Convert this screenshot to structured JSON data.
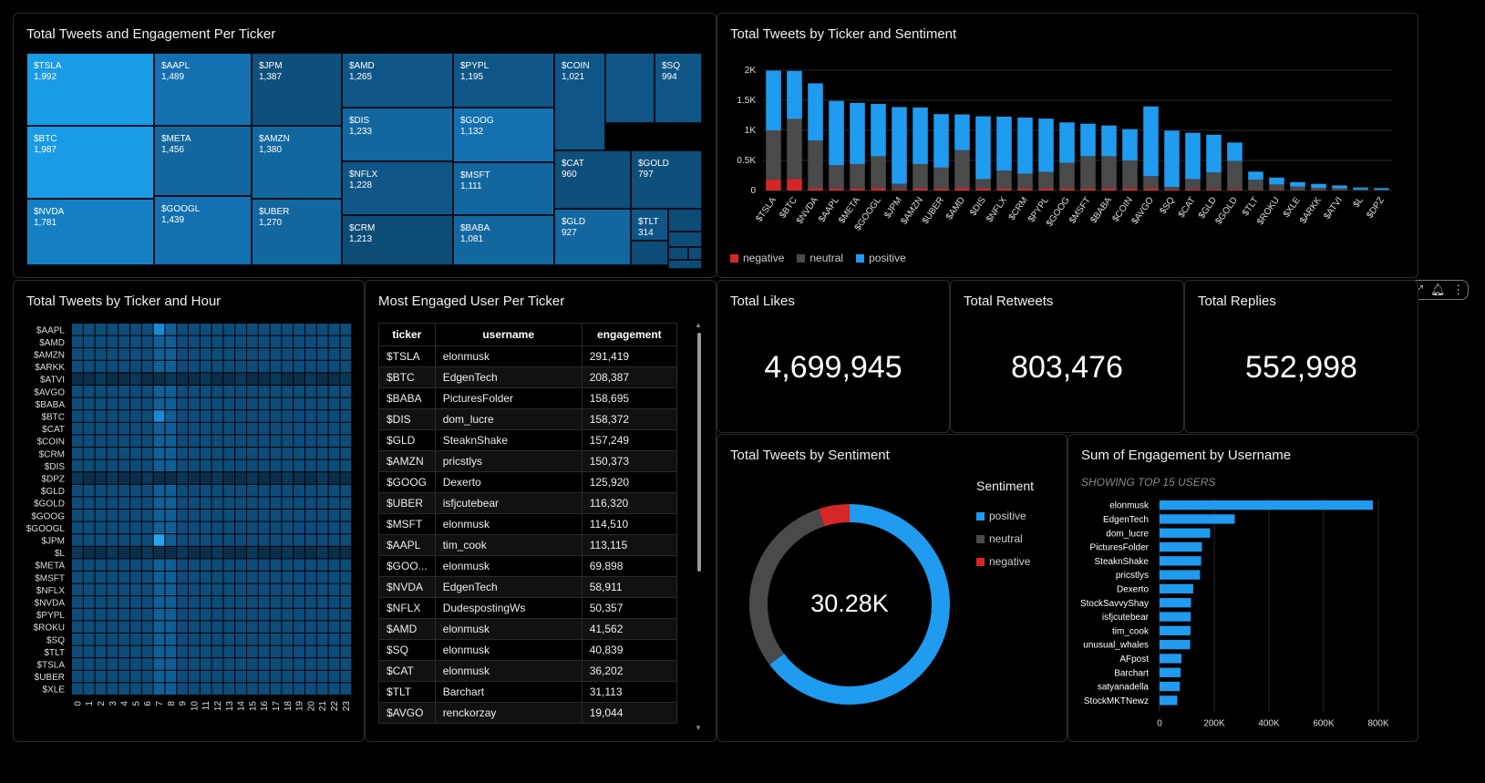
{
  "treemap": {
    "title": "Total Tweets and Engagement Per Ticker",
    "cells": [
      {
        "label": "$TSLA",
        "value": "1,992",
        "color": "#1a9be6"
      },
      {
        "label": "$BTC",
        "value": "1,987",
        "color": "#1a9be6"
      },
      {
        "label": "$NVDA",
        "value": "1,781",
        "color": "#157fc4"
      },
      {
        "label": "$AAPL",
        "value": "1,489",
        "color": "#1470b0"
      },
      {
        "label": "$META",
        "value": "1,456",
        "color": "#13679f"
      },
      {
        "label": "$GOOGL",
        "value": "1,439",
        "color": "#1470b0"
      },
      {
        "label": "$JPM",
        "value": "1,387",
        "color": "#0e4f7c"
      },
      {
        "label": "$AMZN",
        "value": "1,380",
        "color": "#13679f"
      },
      {
        "label": "$UBER",
        "value": "1,270",
        "color": "#13679f"
      },
      {
        "label": "$AMD",
        "value": "1,265",
        "color": "#0f5687"
      },
      {
        "label": "$DIS",
        "value": "1,233",
        "color": "#13679f"
      },
      {
        "label": "$NFLX",
        "value": "1,228",
        "color": "#0f5687"
      },
      {
        "label": "$CRM",
        "value": "1,213",
        "color": "#0d4c77"
      },
      {
        "label": "$PYPL",
        "value": "1,195",
        "color": "#0f5687"
      },
      {
        "label": "$GOOG",
        "value": "1,132",
        "color": "#1470b0"
      },
      {
        "label": "$MSFT",
        "value": "1,111",
        "color": "#13679f"
      },
      {
        "label": "$BABA",
        "value": "1,081",
        "color": "#13679f"
      },
      {
        "label": "$COIN",
        "value": "1,021",
        "color": "#0f5687"
      },
      {
        "label": "",
        "value": "",
        "color": "#0f5687"
      },
      {
        "label": "$SQ",
        "value": "994",
        "color": "#0f5687"
      },
      {
        "label": "$CAT",
        "value": "960",
        "color": "#0e4f7c"
      },
      {
        "label": "$GOLD",
        "value": "797",
        "color": "#0e4f7c"
      },
      {
        "label": "$GLD",
        "value": "927",
        "color": "#13679f"
      },
      {
        "label": "$TLT",
        "value": "314",
        "color": "#0f5687"
      },
      {
        "label": "",
        "value": "",
        "color": "#0d4c77"
      },
      {
        "label": "",
        "value": "",
        "color": "#0d4c77"
      },
      {
        "label": "",
        "value": "",
        "color": "#0d4c77"
      },
      {
        "label": "",
        "value": "",
        "color": "#0d4c77"
      },
      {
        "label": "",
        "value": "",
        "color": "#0d4c77"
      },
      {
        "label": "",
        "value": "",
        "color": "#0d4c77"
      }
    ]
  },
  "sentiment_chart": {
    "title": "Total Tweets by Ticker and Sentiment",
    "legend": [
      {
        "label": "negative",
        "color": "#d62728"
      },
      {
        "label": "neutral",
        "color": "#4a4a4a"
      },
      {
        "label": "positive",
        "color": "#1f9bef"
      }
    ]
  },
  "heatmap": {
    "title": "Total Tweets by Ticker and Hour",
    "rows": [
      "$AAPL",
      "$AMD",
      "$AMZN",
      "$ARKK",
      "$ATVI",
      "$AVGO",
      "$BABA",
      "$BTC",
      "$CAT",
      "$COIN",
      "$CRM",
      "$DIS",
      "$DPZ",
      "$GLD",
      "$GOLD",
      "$GOOG",
      "$GOOGL",
      "$JPM",
      "$L",
      "$META",
      "$MSFT",
      "$NFLX",
      "$NVDA",
      "$PYPL",
      "$ROKU",
      "$SQ",
      "$TLT",
      "$TSLA",
      "$UBER",
      "$XLE"
    ],
    "cols": [
      "0",
      "1",
      "2",
      "3",
      "4",
      "5",
      "6",
      "7",
      "8",
      "9",
      "10",
      "11",
      "12",
      "13",
      "14",
      "15",
      "16",
      "17",
      "18",
      "19",
      "20",
      "21",
      "22",
      "23"
    ]
  },
  "users_table": {
    "title": "Most Engaged User Per Ticker",
    "headers": [
      "ticker",
      "username",
      "engagement"
    ],
    "rows": [
      [
        "$TSLA",
        "elonmusk",
        "291,419"
      ],
      [
        "$BTC",
        "EdgenTech",
        "208,387"
      ],
      [
        "$BABA",
        "PicturesFolder",
        "158,695"
      ],
      [
        "$DIS",
        "dom_lucre",
        "158,372"
      ],
      [
        "$GLD",
        "SteaknShake",
        "157,249"
      ],
      [
        "$AMZN",
        "pricstlys",
        "150,373"
      ],
      [
        "$GOOG",
        "Dexerto",
        "125,920"
      ],
      [
        "$UBER",
        "isfjcutebear",
        "116,320"
      ],
      [
        "$MSFT",
        "elonmusk",
        "114,510"
      ],
      [
        "$AAPL",
        "tim_cook",
        "113,115"
      ],
      [
        "$GOO...",
        "elonmusk",
        "69,898"
      ],
      [
        "$NVDA",
        "EdgenTech",
        "58,911"
      ],
      [
        "$NFLX",
        "DudespostingWs",
        "50,357"
      ],
      [
        "$AMD",
        "elonmusk",
        "41,562"
      ],
      [
        "$SQ",
        "elonmusk",
        "40,839"
      ],
      [
        "$CAT",
        "elonmusk",
        "36,202"
      ],
      [
        "$TLT",
        "Barchart",
        "31,113"
      ],
      [
        "$AVGO",
        "renckorzay",
        "19,044"
      ]
    ]
  },
  "kpis": {
    "likes": {
      "title": "Total Likes",
      "value": "4,699,945"
    },
    "retweets": {
      "title": "Total Retweets",
      "value": "803,476"
    },
    "replies": {
      "title": "Total Replies",
      "value": "552,998"
    }
  },
  "donut": {
    "title": "Total Tweets by Sentiment",
    "center": "30.28K",
    "legend_title": "Sentiment",
    "legend": [
      {
        "label": "positive",
        "color": "#1f9bef"
      },
      {
        "label": "neutral",
        "color": "#4a4a4a"
      },
      {
        "label": "negative",
        "color": "#d62728"
      }
    ]
  },
  "engagement": {
    "title": "Sum of Engagement by Username",
    "subtitle": "SHOWING TOP 15 USERS"
  },
  "chart_data": [
    {
      "type": "bar",
      "stacked": true,
      "title": "Total Tweets by Ticker and Sentiment",
      "categories": [
        "$TSLA",
        "$BTC",
        "$NVDA",
        "$AAPL",
        "$META",
        "$GOOGL",
        "$JPM",
        "$AMZN",
        "$UBER",
        "$AMD",
        "$DIS",
        "$NFLX",
        "$CRM",
        "$PYPL",
        "$GOOG",
        "$MSFT",
        "$BABA",
        "$COIN",
        "$AVGO",
        "$SQ",
        "$CAT",
        "$GLD",
        "$GOLD",
        "$TLT",
        "$ROKU",
        "$XLE",
        "$ARKK",
        "$ATVI",
        "$L",
        "$DPZ"
      ],
      "series": [
        {
          "name": "negative",
          "color": "#d62728",
          "values": [
            180,
            190,
            40,
            30,
            30,
            40,
            20,
            30,
            30,
            40,
            30,
            30,
            30,
            30,
            30,
            30,
            30,
            30,
            30,
            20,
            20,
            20,
            20,
            10,
            10,
            5,
            5,
            5,
            3,
            3
          ]
        },
        {
          "name": "neutral",
          "color": "#4a4a4a",
          "values": [
            820,
            1000,
            790,
            390,
            410,
            530,
            90,
            410,
            350,
            630,
            160,
            300,
            250,
            280,
            430,
            540,
            540,
            470,
            210,
            40,
            170,
            280,
            470,
            170,
            90,
            60,
            40,
            30,
            15,
            10
          ]
        },
        {
          "name": "positive",
          "color": "#1f9bef",
          "values": [
            992,
            797,
            951,
            1069,
            1016,
            869,
            1277,
            940,
            890,
            595,
            1043,
            898,
            933,
            885,
            672,
            541,
            511,
            521,
            1158,
            934,
            770,
            627,
            307,
            134,
            115,
            75,
            65,
            50,
            32,
            27
          ]
        }
      ],
      "ylim": [
        0,
        2000
      ],
      "yticks": [
        "0",
        "0.5K",
        "1K",
        "1.5K",
        "2K"
      ],
      "legend_position": "bottom-left"
    },
    {
      "type": "heatmap",
      "title": "Total Tweets by Ticker and Hour",
      "rows": [
        "$AAPL",
        "$AMD",
        "$AMZN",
        "$ARKK",
        "$ATVI",
        "$AVGO",
        "$BABA",
        "$BTC",
        "$CAT",
        "$COIN",
        "$CRM",
        "$DIS",
        "$DPZ",
        "$GLD",
        "$GOLD",
        "$GOOG",
        "$GOOGL",
        "$JPM",
        "$L",
        "$META",
        "$MSFT",
        "$NFLX",
        "$NVDA",
        "$PYPL",
        "$ROKU",
        "$SQ",
        "$TLT",
        "$TSLA",
        "$UBER",
        "$XLE"
      ],
      "x": [
        "0",
        "1",
        "2",
        "3",
        "4",
        "5",
        "6",
        "7",
        "8",
        "9",
        "10",
        "11",
        "12",
        "13",
        "14",
        "15",
        "16",
        "17",
        "18",
        "19",
        "20",
        "21",
        "22",
        "23"
      ]
    },
    {
      "type": "pie",
      "donut": true,
      "title": "Total Tweets by Sentiment",
      "categories": [
        "positive",
        "neutral",
        "negative"
      ],
      "values": [
        19600,
        9170,
        1510
      ],
      "total_label": "30.28K"
    },
    {
      "type": "bar",
      "orientation": "horizontal",
      "title": "Sum of Engagement by Username",
      "categories": [
        "elonmusk",
        "EdgenTech",
        "dom_lucre",
        "PicturesFolder",
        "SteaknShake",
        "pricstlys",
        "Dexerto",
        "StockSavvyShay",
        "isfjcutebear",
        "tim_cook",
        "unusual_whales",
        "AFpost",
        "Barchart",
        "satyanadella",
        "StockMKTNewz"
      ],
      "values": [
        780000,
        275000,
        185000,
        155000,
        152000,
        148000,
        123000,
        115000,
        114000,
        113000,
        112000,
        80000,
        77000,
        74000,
        65000
      ],
      "xlim": [
        0,
        800000
      ],
      "xticks": [
        "0",
        "200K",
        "400K",
        "600K",
        "800K"
      ]
    }
  ]
}
